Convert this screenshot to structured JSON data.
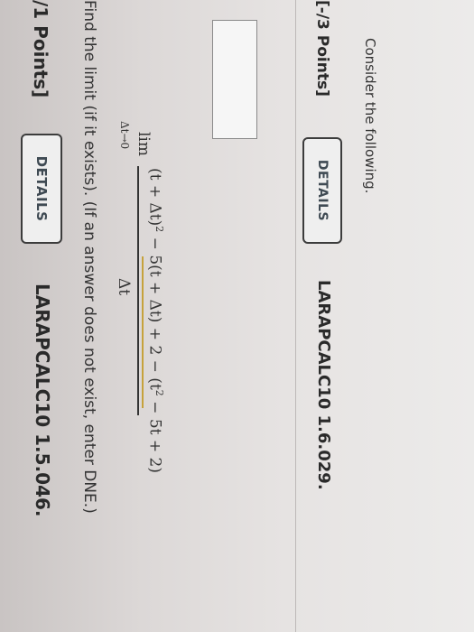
{
  "q1": {
    "points": "/1 Points]",
    "details_label": "DETAILS",
    "code": "LARAPCALC10 1.5.046.",
    "prompt": "Find the limit (if it exists). (If an answer does not exist, enter DNE.)",
    "lim": "lim",
    "lim_sub": "Δt→0",
    "numerator_a": "(t + Δt)",
    "numerator_a_exp": "2",
    "numerator_b": " − 5(t + Δt) + 2 − (t",
    "numerator_b_exp": "2",
    "numerator_c": " − 5t + 2)",
    "denominator": "Δt",
    "answer_value": ""
  },
  "q2": {
    "points": "[-/3 Points]",
    "details_label": "DETAILS",
    "code": "LARAPCALC10 1.6.029.",
    "prompt": "Consider the following."
  },
  "colors": {
    "highlight": "#c6a23c",
    "button_border": "#3c3c3c"
  }
}
